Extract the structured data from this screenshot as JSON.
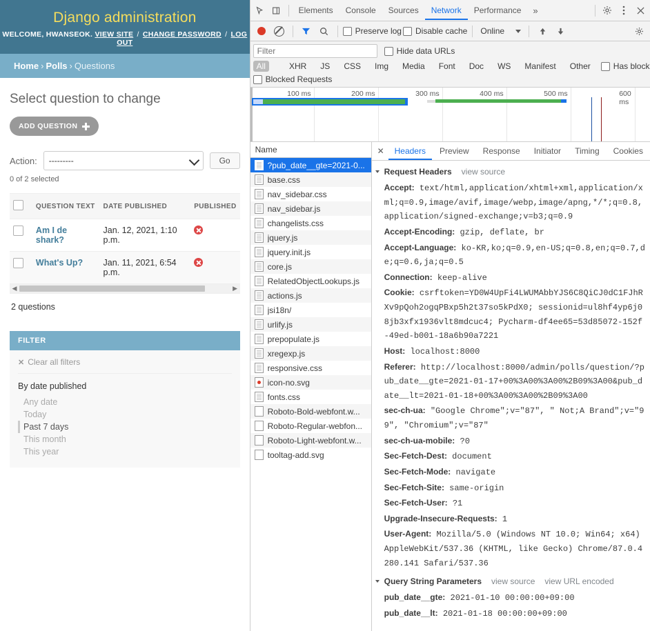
{
  "django": {
    "site_title": "Django administration",
    "welcome_prefix": "WELCOME,",
    "username": "HWANSEOK.",
    "links": {
      "view_site": "VIEW SITE",
      "change_password": "CHANGE PASSWORD",
      "log_out": "LOG OUT",
      "separator": "/"
    },
    "breadcrumbs": {
      "home": "Home",
      "app": "Polls",
      "current": "Questions",
      "separator": "›"
    },
    "page_title": "Select question to change",
    "add_button": "ADD QUESTION",
    "action": {
      "label": "Action:",
      "selected": "---------",
      "go": "Go",
      "selected_count": "0 of 2 selected"
    },
    "table": {
      "columns": [
        "QUESTION TEXT",
        "DATE PUBLISHED",
        "PUBLISHED"
      ],
      "rows": [
        {
          "question": "Am I de shark?",
          "date": "Jan. 12, 2021, 1:10 p.m.",
          "published": "no"
        },
        {
          "question": "What's Up?",
          "date": "Jan. 11, 2021, 6:54 p.m.",
          "published": "no"
        }
      ],
      "result_count": "2 questions"
    },
    "filter": {
      "header": "FILTER",
      "clear_all": "Clear all filters",
      "group_title": "By date published",
      "options": [
        "Any date",
        "Today",
        "Past 7 days",
        "This month",
        "This year"
      ],
      "selected": "Past 7 days"
    },
    "colors": {
      "header_bg": "#417690",
      "breadcrumb_bg": "#79aec8",
      "title": "#f5dd5d",
      "link": "#447e9b"
    }
  },
  "devtools": {
    "panels": [
      "Elements",
      "Console",
      "Sources",
      "Network",
      "Performance"
    ],
    "active_panel": "Network",
    "more_tabs": "»",
    "toolbar": {
      "preserve_log": "Preserve log",
      "disable_cache": "Disable cache",
      "throttle": "Online"
    },
    "filter_bar": {
      "filter_placeholder": "Filter",
      "hide_data_urls": "Hide data URLs",
      "types": [
        "All",
        "XHR",
        "JS",
        "CSS",
        "Img",
        "Media",
        "Font",
        "Doc",
        "WS",
        "Manifest",
        "Other"
      ],
      "active_type": "All",
      "has_blocked_cookies": "Has blocked cookies",
      "blocked_requests": "Blocked Requests"
    },
    "overview": {
      "ticks": [
        "100 ms",
        "200 ms",
        "300 ms",
        "400 ms",
        "500 ms",
        "600 ms"
      ]
    },
    "requests": {
      "column_header": "Name",
      "selected": "?pub_date__gte=2021-0...",
      "items": [
        {
          "name": "?pub_date__gte=2021-0...",
          "type": "doc",
          "selected": true
        },
        {
          "name": "base.css",
          "type": "doc"
        },
        {
          "name": "nav_sidebar.css",
          "type": "doc"
        },
        {
          "name": "nav_sidebar.js",
          "type": "doc"
        },
        {
          "name": "changelists.css",
          "type": "doc"
        },
        {
          "name": "jquery.js",
          "type": "doc"
        },
        {
          "name": "jquery.init.js",
          "type": "doc"
        },
        {
          "name": "core.js",
          "type": "doc"
        },
        {
          "name": "RelatedObjectLookups.js",
          "type": "doc"
        },
        {
          "name": "actions.js",
          "type": "doc"
        },
        {
          "name": "jsi18n/",
          "type": "doc"
        },
        {
          "name": "urlify.js",
          "type": "doc"
        },
        {
          "name": "prepopulate.js",
          "type": "doc"
        },
        {
          "name": "xregexp.js",
          "type": "doc"
        },
        {
          "name": "responsive.css",
          "type": "doc"
        },
        {
          "name": "icon-no.svg",
          "type": "img"
        },
        {
          "name": "fonts.css",
          "type": "doc"
        },
        {
          "name": "Roboto-Bold-webfont.w...",
          "type": "font"
        },
        {
          "name": "Roboto-Regular-webfon...",
          "type": "font"
        },
        {
          "name": "Roboto-Light-webfont.w...",
          "type": "font"
        },
        {
          "name": "tooltag-add.svg",
          "type": "font"
        }
      ]
    },
    "detail": {
      "tabs": [
        "Headers",
        "Preview",
        "Response",
        "Initiator",
        "Timing",
        "Cookies"
      ],
      "active_tab": "Headers",
      "request_headers": {
        "title": "Request Headers",
        "view_source": "view source",
        "items": [
          {
            "name": "Accept:",
            "value": "text/html,application/xhtml+xml,application/xml;q=0.9,image/avif,image/webp,image/apng,*/*;q=0.8,application/signed-exchange;v=b3;q=0.9"
          },
          {
            "name": "Accept-Encoding:",
            "value": "gzip, deflate, br"
          },
          {
            "name": "Accept-Language:",
            "value": "ko-KR,ko;q=0.9,en-US;q=0.8,en;q=0.7,de;q=0.6,ja;q=0.5"
          },
          {
            "name": "Connection:",
            "value": "keep-alive"
          },
          {
            "name": "Cookie:",
            "value": "csrftoken=YD0W4UpFi4LWUMAbbYJS6C8QiCJ0dC1FJhRXv9pQoh2ogqPBxp5h2t37so5kPdX0; sessionid=ul8hf4yp6j08jb3xfx1936vlt8mdcuc4; Pycharm-df4ee65=53d85072-152f-49ed-b001-18a6b90a7221"
          },
          {
            "name": "Host:",
            "value": "localhost:8000"
          },
          {
            "name": "Referer:",
            "value": "http://localhost:8000/admin/polls/question/?pub_date__gte=2021-01-17+00%3A00%3A00%2B09%3A00&pub_date__lt=2021-01-18+00%3A00%3A00%2B09%3A00"
          },
          {
            "name": "sec-ch-ua:",
            "value": "\"Google Chrome\";v=\"87\", \" Not;A Brand\";v=\"99\", \"Chromium\";v=\"87\""
          },
          {
            "name": "sec-ch-ua-mobile:",
            "value": "?0"
          },
          {
            "name": "Sec-Fetch-Dest:",
            "value": "document"
          },
          {
            "name": "Sec-Fetch-Mode:",
            "value": "navigate"
          },
          {
            "name": "Sec-Fetch-Site:",
            "value": "same-origin"
          },
          {
            "name": "Sec-Fetch-User:",
            "value": "?1"
          },
          {
            "name": "Upgrade-Insecure-Requests:",
            "value": "1"
          },
          {
            "name": "User-Agent:",
            "value": "Mozilla/5.0 (Windows NT 10.0; Win64; x64) AppleWebKit/537.36 (KHTML, like Gecko) Chrome/87.0.4280.141 Safari/537.36"
          }
        ]
      },
      "query_string": {
        "title": "Query String Parameters",
        "view_source": "view source",
        "view_url_encoded": "view URL encoded",
        "items": [
          {
            "name": "pub_date__gte:",
            "value": "2021-01-10 00:00:00+09:00"
          },
          {
            "name": "pub_date__lt:",
            "value": "2021-01-18 00:00:00+09:00"
          }
        ]
      }
    },
    "colors": {
      "accent": "#1a73e8",
      "record": "#db3a28",
      "toolbar_bg": "#f3f3f3"
    }
  }
}
